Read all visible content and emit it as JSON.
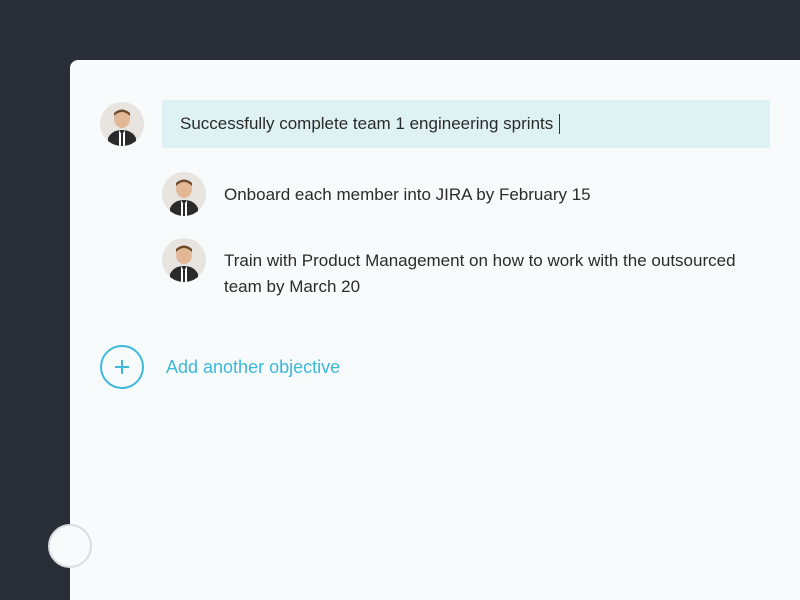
{
  "colors": {
    "accent": "#3db8da",
    "highlight_bg": "#def1f3",
    "page_bg": "#f8fbfc",
    "frame_bg": "#2a2e37"
  },
  "objective": {
    "main": "Successfully complete team 1 engineering sprints",
    "subs": [
      "Onboard each member into JIRA by February 15",
      "Train with Product Management on how to work with the outsourced team by March 20"
    ]
  },
  "add_objective_label": "Add another objective",
  "avatar_alt": "team-member-avatar"
}
